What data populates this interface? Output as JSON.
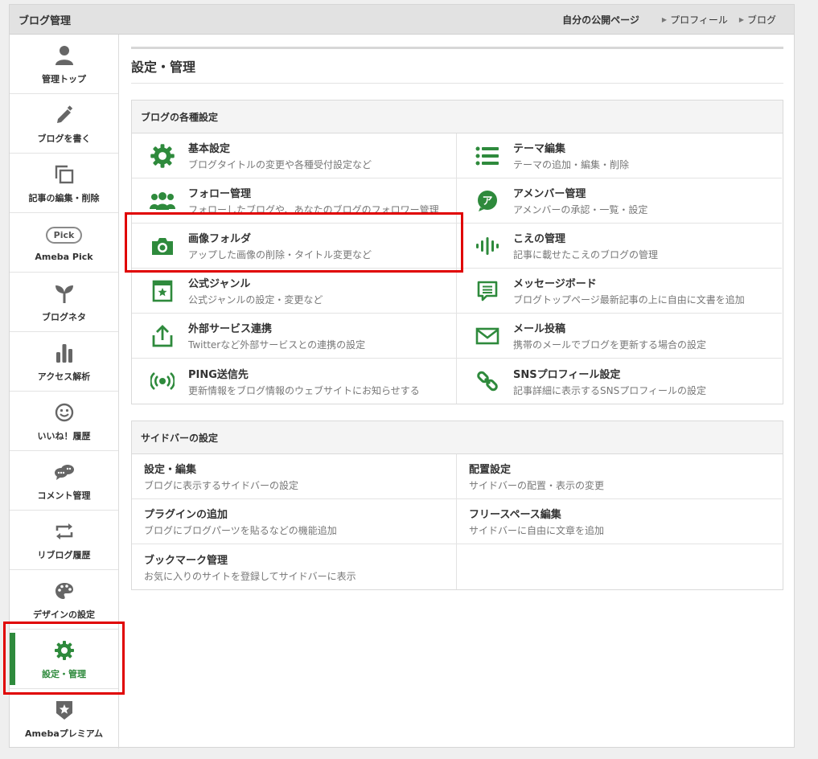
{
  "header": {
    "app_title": "ブログ管理",
    "my_page": "自分の公開ページ",
    "profile": "プロフィール",
    "blog": "ブログ"
  },
  "sidebar": {
    "items": [
      {
        "label": "管理トップ",
        "icon": "person-icon"
      },
      {
        "label": "ブログを書く",
        "icon": "pencil-icon"
      },
      {
        "label": "記事の編集・削除",
        "icon": "copy-icon"
      },
      {
        "label": "Ameba Pick",
        "icon": "pick-icon",
        "badge": "Pick"
      },
      {
        "label": "ブログネタ",
        "icon": "sprout-icon"
      },
      {
        "label": "アクセス解析",
        "icon": "bar-chart-icon"
      },
      {
        "label": "いいね！履歴",
        "icon": "smile-icon"
      },
      {
        "label": "コメント管理",
        "icon": "chat-icon"
      },
      {
        "label": "リブログ履歴",
        "icon": "reblog-icon"
      },
      {
        "label": "デザインの設定",
        "icon": "palette-icon"
      },
      {
        "label": "設定・管理",
        "icon": "gear-icon",
        "active": true
      },
      {
        "label": "Amebaプレミアム",
        "icon": "premium-star-icon"
      }
    ]
  },
  "main": {
    "title": "設定・管理",
    "blog_settings": {
      "heading": "ブログの各種設定",
      "items": [
        {
          "title": "基本設定",
          "desc": "ブログタイトルの変更や各種受付設定など",
          "icon": "gear-icon"
        },
        {
          "title": "テーマ編集",
          "desc": "テーマの追加・編集・削除",
          "icon": "list-icon"
        },
        {
          "title": "フォロー管理",
          "desc": "フォローしたブログや、あなたのブログのフォロワー管理",
          "icon": "people-icon"
        },
        {
          "title": "アメンバー管理",
          "desc": "アメンバーの承認・一覧・設定",
          "icon": "amember-icon"
        },
        {
          "title": "画像フォルダ",
          "desc": "アップした画像の削除・タイトル変更など",
          "icon": "camera-icon"
        },
        {
          "title": "こえの管理",
          "desc": "記事に載せたこえのブログの管理",
          "icon": "voice-wave-icon"
        },
        {
          "title": "公式ジャンル",
          "desc": "公式ジャンルの設定・変更など",
          "icon": "genre-star-icon"
        },
        {
          "title": "メッセージボード",
          "desc": "ブログトップページ最新記事の上に自由に文書を追加",
          "icon": "message-board-icon"
        },
        {
          "title": "外部サービス連携",
          "desc": "Twitterなど外部サービスとの連携の設定",
          "icon": "share-upload-icon"
        },
        {
          "title": "メール投稿",
          "desc": "携帯のメールでブログを更新する場合の設定",
          "icon": "mail-icon"
        },
        {
          "title": "PING送信先",
          "desc": "更新情報をブログ情報のウェブサイトにお知らせする",
          "icon": "ping-signal-icon"
        },
        {
          "title": "SNSプロフィール設定",
          "desc": "記事詳細に表示するSNSプロフィールの設定",
          "icon": "link-icon"
        }
      ]
    },
    "sidebar_settings": {
      "heading": "サイドバーの設定",
      "items": [
        {
          "title": "設定・編集",
          "desc": "ブログに表示するサイドバーの設定"
        },
        {
          "title": "配置設定",
          "desc": "サイドバーの配置・表示の変更"
        },
        {
          "title": "プラグインの追加",
          "desc": "ブログにブログパーツを貼るなどの機能追加"
        },
        {
          "title": "フリースペース編集",
          "desc": "サイドバーに自由に文章を追加"
        },
        {
          "title": "ブックマーク管理",
          "desc": "お気に入りのサイトを登録してサイドバーに表示"
        }
      ]
    }
  },
  "colors": {
    "accent_green": "#2e8a3c",
    "highlight_red": "#e00000",
    "icon_gray": "#666666"
  }
}
